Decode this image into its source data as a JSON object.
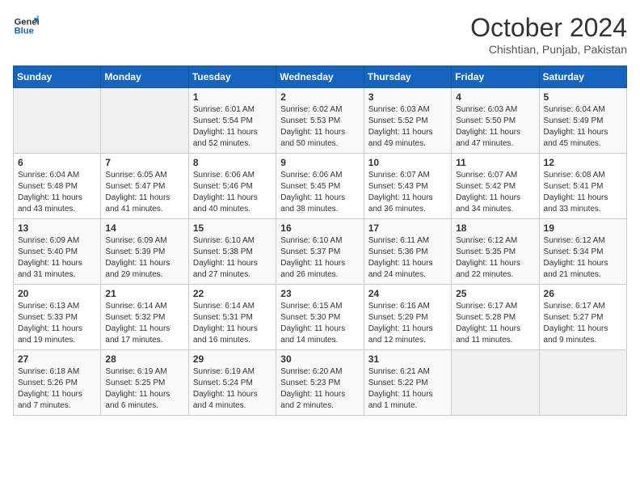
{
  "header": {
    "logo_line1": "General",
    "logo_line2": "Blue",
    "month": "October 2024",
    "location": "Chishtian, Punjab, Pakistan"
  },
  "weekdays": [
    "Sunday",
    "Monday",
    "Tuesday",
    "Wednesday",
    "Thursday",
    "Friday",
    "Saturday"
  ],
  "weeks": [
    [
      {
        "day": "",
        "info": ""
      },
      {
        "day": "",
        "info": ""
      },
      {
        "day": "1",
        "info": "Sunrise: 6:01 AM\nSunset: 5:54 PM\nDaylight: 11 hours\nand 52 minutes."
      },
      {
        "day": "2",
        "info": "Sunrise: 6:02 AM\nSunset: 5:53 PM\nDaylight: 11 hours\nand 50 minutes."
      },
      {
        "day": "3",
        "info": "Sunrise: 6:03 AM\nSunset: 5:52 PM\nDaylight: 11 hours\nand 49 minutes."
      },
      {
        "day": "4",
        "info": "Sunrise: 6:03 AM\nSunset: 5:50 PM\nDaylight: 11 hours\nand 47 minutes."
      },
      {
        "day": "5",
        "info": "Sunrise: 6:04 AM\nSunset: 5:49 PM\nDaylight: 11 hours\nand 45 minutes."
      }
    ],
    [
      {
        "day": "6",
        "info": "Sunrise: 6:04 AM\nSunset: 5:48 PM\nDaylight: 11 hours\nand 43 minutes."
      },
      {
        "day": "7",
        "info": "Sunrise: 6:05 AM\nSunset: 5:47 PM\nDaylight: 11 hours\nand 41 minutes."
      },
      {
        "day": "8",
        "info": "Sunrise: 6:06 AM\nSunset: 5:46 PM\nDaylight: 11 hours\nand 40 minutes."
      },
      {
        "day": "9",
        "info": "Sunrise: 6:06 AM\nSunset: 5:45 PM\nDaylight: 11 hours\nand 38 minutes."
      },
      {
        "day": "10",
        "info": "Sunrise: 6:07 AM\nSunset: 5:43 PM\nDaylight: 11 hours\nand 36 minutes."
      },
      {
        "day": "11",
        "info": "Sunrise: 6:07 AM\nSunset: 5:42 PM\nDaylight: 11 hours\nand 34 minutes."
      },
      {
        "day": "12",
        "info": "Sunrise: 6:08 AM\nSunset: 5:41 PM\nDaylight: 11 hours\nand 33 minutes."
      }
    ],
    [
      {
        "day": "13",
        "info": "Sunrise: 6:09 AM\nSunset: 5:40 PM\nDaylight: 11 hours\nand 31 minutes."
      },
      {
        "day": "14",
        "info": "Sunrise: 6:09 AM\nSunset: 5:39 PM\nDaylight: 11 hours\nand 29 minutes."
      },
      {
        "day": "15",
        "info": "Sunrise: 6:10 AM\nSunset: 5:38 PM\nDaylight: 11 hours\nand 27 minutes."
      },
      {
        "day": "16",
        "info": "Sunrise: 6:10 AM\nSunset: 5:37 PM\nDaylight: 11 hours\nand 26 minutes."
      },
      {
        "day": "17",
        "info": "Sunrise: 6:11 AM\nSunset: 5:36 PM\nDaylight: 11 hours\nand 24 minutes."
      },
      {
        "day": "18",
        "info": "Sunrise: 6:12 AM\nSunset: 5:35 PM\nDaylight: 11 hours\nand 22 minutes."
      },
      {
        "day": "19",
        "info": "Sunrise: 6:12 AM\nSunset: 5:34 PM\nDaylight: 11 hours\nand 21 minutes."
      }
    ],
    [
      {
        "day": "20",
        "info": "Sunrise: 6:13 AM\nSunset: 5:33 PM\nDaylight: 11 hours\nand 19 minutes."
      },
      {
        "day": "21",
        "info": "Sunrise: 6:14 AM\nSunset: 5:32 PM\nDaylight: 11 hours\nand 17 minutes."
      },
      {
        "day": "22",
        "info": "Sunrise: 6:14 AM\nSunset: 5:31 PM\nDaylight: 11 hours\nand 16 minutes."
      },
      {
        "day": "23",
        "info": "Sunrise: 6:15 AM\nSunset: 5:30 PM\nDaylight: 11 hours\nand 14 minutes."
      },
      {
        "day": "24",
        "info": "Sunrise: 6:16 AM\nSunset: 5:29 PM\nDaylight: 11 hours\nand 12 minutes."
      },
      {
        "day": "25",
        "info": "Sunrise: 6:17 AM\nSunset: 5:28 PM\nDaylight: 11 hours\nand 11 minutes."
      },
      {
        "day": "26",
        "info": "Sunrise: 6:17 AM\nSunset: 5:27 PM\nDaylight: 11 hours\nand 9 minutes."
      }
    ],
    [
      {
        "day": "27",
        "info": "Sunrise: 6:18 AM\nSunset: 5:26 PM\nDaylight: 11 hours\nand 7 minutes."
      },
      {
        "day": "28",
        "info": "Sunrise: 6:19 AM\nSunset: 5:25 PM\nDaylight: 11 hours\nand 6 minutes."
      },
      {
        "day": "29",
        "info": "Sunrise: 6:19 AM\nSunset: 5:24 PM\nDaylight: 11 hours\nand 4 minutes."
      },
      {
        "day": "30",
        "info": "Sunrise: 6:20 AM\nSunset: 5:23 PM\nDaylight: 11 hours\nand 2 minutes."
      },
      {
        "day": "31",
        "info": "Sunrise: 6:21 AM\nSunset: 5:22 PM\nDaylight: 11 hours\nand 1 minute."
      },
      {
        "day": "",
        "info": ""
      },
      {
        "day": "",
        "info": ""
      }
    ]
  ]
}
